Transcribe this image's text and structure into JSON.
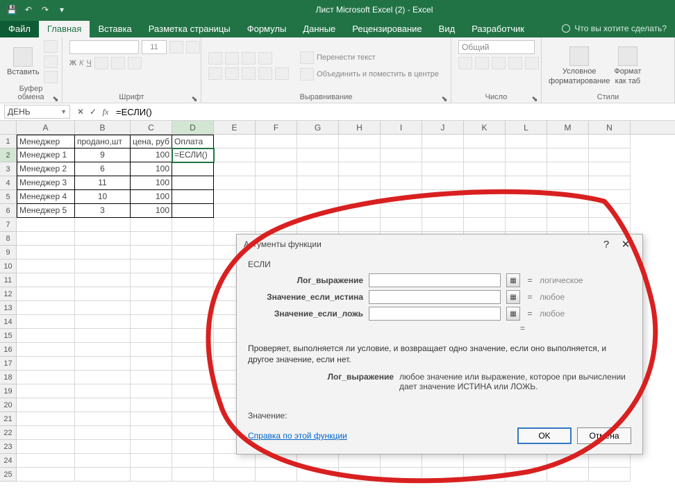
{
  "window": {
    "title": "Лист Microsoft Excel (2) - Excel"
  },
  "tabs": {
    "file": "Файл",
    "home": "Главная",
    "insert": "Вставка",
    "pagelayout": "Разметка страницы",
    "formulas": "Формулы",
    "data": "Данные",
    "review": "Рецензирование",
    "view": "Вид",
    "developer": "Разработчик",
    "tellme": "Что вы хотите сделать?"
  },
  "ribbon": {
    "clipboard": {
      "paste": "Вставить",
      "label": "Буфер обмена"
    },
    "font": {
      "size": "11",
      "label": "Шрифт"
    },
    "alignment": {
      "wrap": "Перенести текст",
      "merge": "Объединить и поместить в центре",
      "label": "Выравнивание"
    },
    "number": {
      "format": "Общий",
      "label": "Число"
    },
    "styles": {
      "condfmt": "Условное",
      "condfmt2": "форматирование",
      "fmttable": "Формат",
      "fmttable2": "как таб",
      "label": "Стили"
    }
  },
  "namebox": "ДЕНЬ",
  "formula": "=ЕСЛИ()",
  "cols": [
    "A",
    "B",
    "C",
    "D",
    "E",
    "F",
    "G",
    "H",
    "I",
    "J",
    "K",
    "L",
    "M",
    "N"
  ],
  "table": {
    "headers": [
      "Менеджер",
      "продано,шт",
      "цена, руб",
      "Оплата"
    ],
    "rows": [
      {
        "m": "Менеджер 1",
        "q": "9",
        "p": "100",
        "pay": "=ЕСЛИ()"
      },
      {
        "m": "Менеджер 2",
        "q": "6",
        "p": "100",
        "pay": ""
      },
      {
        "m": "Менеджер 3",
        "q": "11",
        "p": "100",
        "pay": ""
      },
      {
        "m": "Менеджер 4",
        "q": "10",
        "p": "100",
        "pay": ""
      },
      {
        "m": "Менеджер 5",
        "q": "3",
        "p": "100",
        "pay": ""
      }
    ]
  },
  "dialog": {
    "title": "Аргументы функции",
    "fn": "ЕСЛИ",
    "args": {
      "logexp": {
        "label": "Лог_выражение",
        "hint": "логическое"
      },
      "iftrue": {
        "label": "Значение_если_истина",
        "hint": "любое"
      },
      "iffalse": {
        "label": "Значение_если_ложь",
        "hint": "любое"
      }
    },
    "eq": "=",
    "desc": "Проверяет, выполняется ли условие, и возвращает одно значение, если оно выполняется, и другое значение, если нет.",
    "argdesc_label": "Лог_выражение",
    "argdesc_text": "любое значение или выражение, которое при вычислении дает значение ИСТИНА или ЛОЖЬ.",
    "result_label": "Значение:",
    "help": "Справка по этой функции",
    "ok": "OK",
    "cancel": "Отмена"
  }
}
